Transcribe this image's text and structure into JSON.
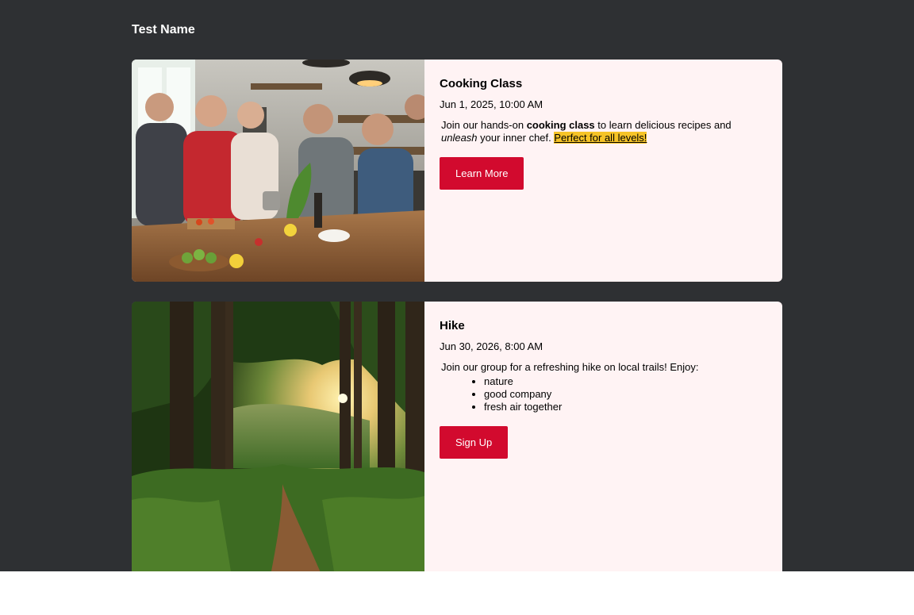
{
  "header": {
    "title": "Test Name"
  },
  "events": [
    {
      "title": "Cooking Class",
      "date": "Jun 1, 2025, 10:00 AM",
      "desc_1": "Join our hands-on ",
      "desc_bold": "cooking class",
      "desc_2": " to learn delicious recipes and ",
      "desc_italic": "unleash",
      "desc_3": " your inner chef. ",
      "desc_highlight": "Perfect for all levels!",
      "button_label": "Learn More"
    },
    {
      "title": "Hike",
      "date": "Jun 30, 2026, 8:00 AM",
      "desc_intro": "Join our group for a refreshing hike on local trails! Enjoy:",
      "list": [
        "nature",
        "good company",
        "fresh air together"
      ],
      "button_label": "Sign Up"
    }
  ],
  "colors": {
    "page_bg": "#2e3033",
    "card_bg": "#fff3f4",
    "button_bg": "#d20a2e",
    "highlight_bg": "#f6c327"
  }
}
